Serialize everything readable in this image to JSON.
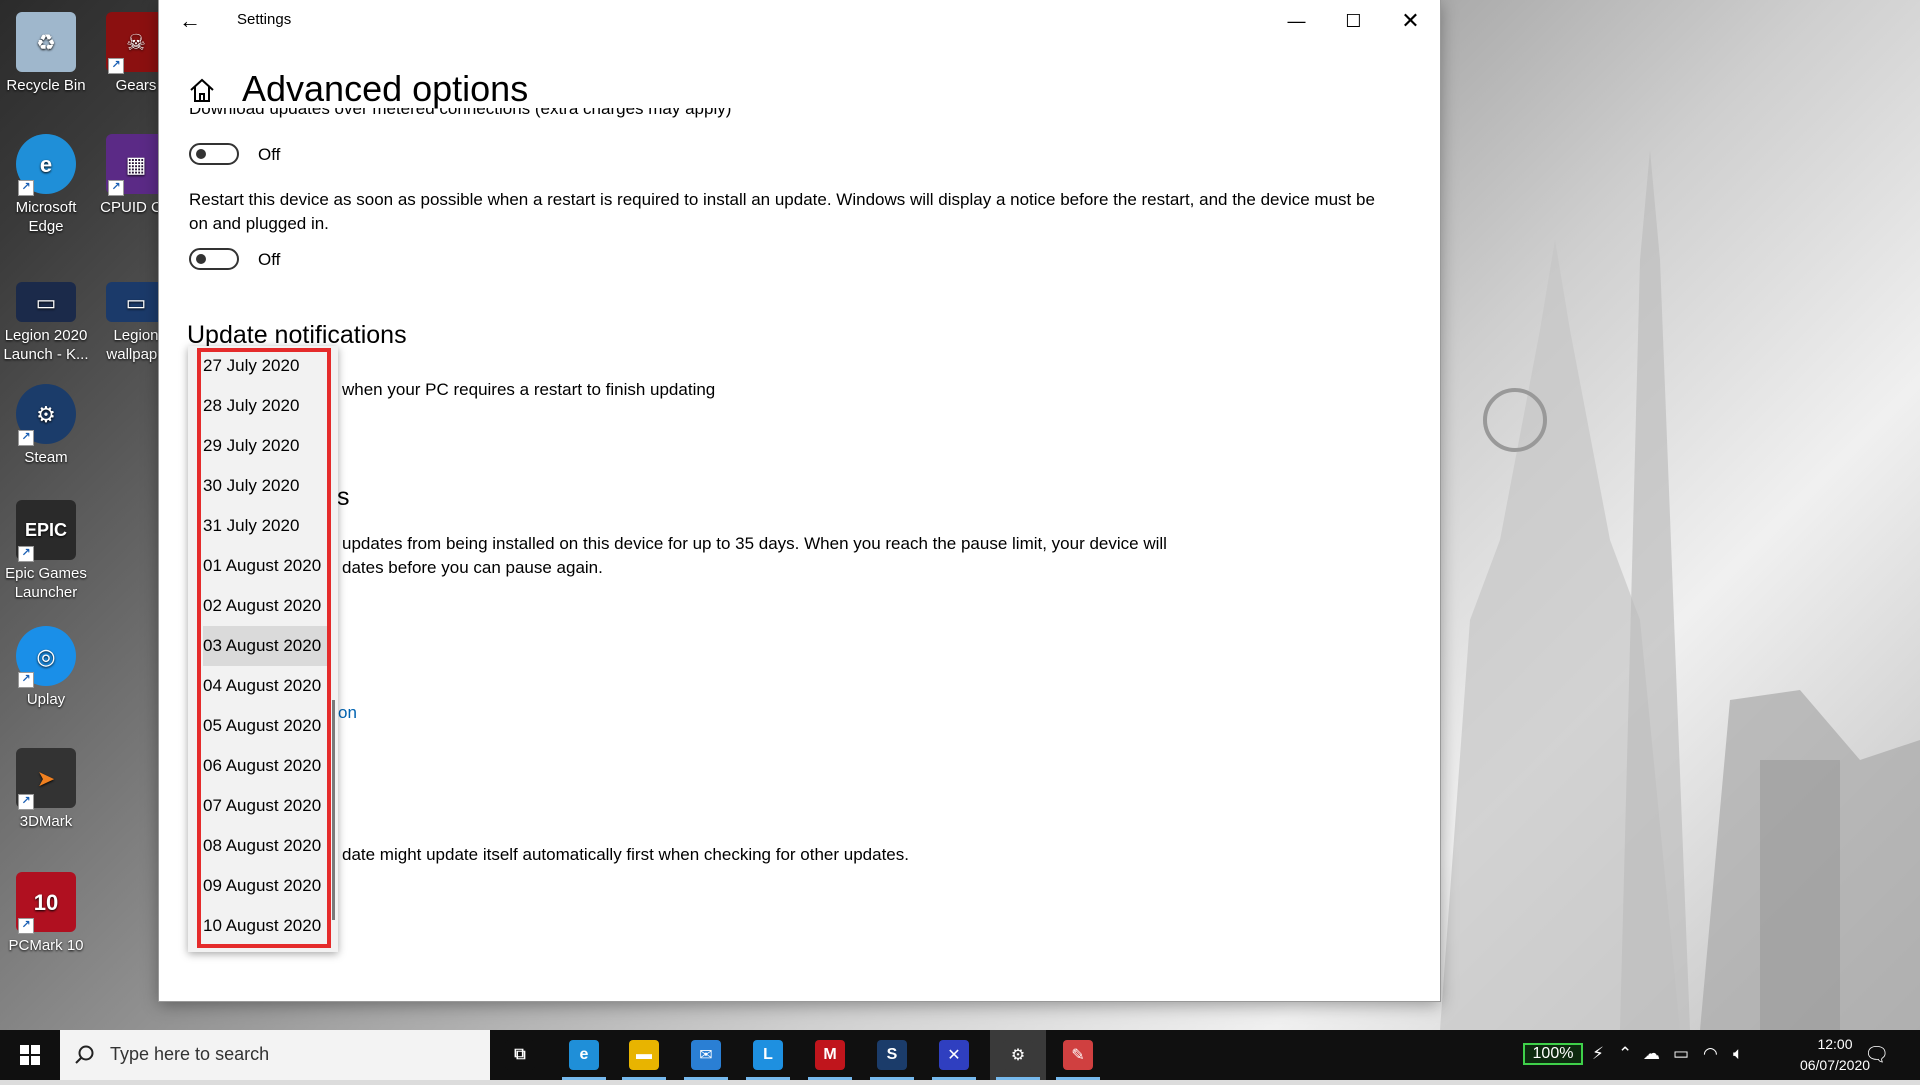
{
  "desktop": {
    "icons": [
      {
        "label": "Recycle Bin",
        "color": "#9fb7cc"
      },
      {
        "label": "Gears",
        "color": "#8b1010"
      },
      {
        "label": "Microsoft Edge",
        "color": "#1f8fd8"
      },
      {
        "label": "CPUID CP",
        "color": "#5b2a86"
      },
      {
        "label": "Legion 2020 Launch - K...",
        "color": "#1b2a4a"
      },
      {
        "label": "Legion wallpape",
        "color": "#1b3a6a"
      },
      {
        "label": "Steam",
        "color": "#1b3c6a"
      },
      {
        "label": "Epic Games Launcher",
        "color": "#2a2a2a"
      },
      {
        "label": "Uplay",
        "color": "#1a8fe8"
      },
      {
        "label": "3DMark",
        "color": "#333333"
      },
      {
        "label": "PCMark 10",
        "color": "#b01020"
      }
    ]
  },
  "window": {
    "title": "Settings",
    "minimize_glyph": "—",
    "maximize_glyph": "☐",
    "close_glyph": "✕",
    "back_glyph": "←"
  },
  "page": {
    "title": "Advanced options",
    "metered_text": "Download updates over metered connections (extra charges may apply)",
    "metered_toggle": "Off",
    "restart_text_line1": "Restart this device as soon as possible when a restart is required to install an update. Windows will display a notice before the restart, and the device must be",
    "restart_text_line2": "on and plugged in.",
    "restart_toggle": "Off",
    "update_notifications_heading": "Update notifications",
    "notify_text_partial": "when your PC requires a restart to finish updating",
    "pause_heading_partial": "s",
    "pause_text_line1_partial": "updates from being installed on this device for up to 35 days. When you reach the pause limit, your device will",
    "pause_text_line2_partial": "dates before you can pause again.",
    "link_partial": "on",
    "note_text_partial": "date might update itself automatically first when checking for other updates."
  },
  "dropdown": {
    "options": [
      "27 July 2020",
      "28 July 2020",
      "29 July 2020",
      "30 July 2020",
      "31 July 2020",
      "01 August 2020",
      "02 August 2020",
      "03 August 2020",
      "04 August 2020",
      "05 August 2020",
      "06 August 2020",
      "07 August 2020",
      "08 August 2020",
      "09 August 2020",
      "10 August 2020"
    ],
    "hovered_index": 7,
    "highlight_color": "#e52b2b"
  },
  "taskbar": {
    "search_placeholder": "Type here to search",
    "apps": [
      {
        "name": "task-view",
        "glyph": "⧉",
        "color": "#101010"
      },
      {
        "name": "edge",
        "glyph": "e",
        "color": "#1f8fd8"
      },
      {
        "name": "file-explorer",
        "glyph": "▬",
        "color": "#e8b400"
      },
      {
        "name": "mail",
        "glyph": "✉",
        "color": "#2a7fd4"
      },
      {
        "name": "lenovo-vantage",
        "glyph": "L",
        "color": "#1e90e0"
      },
      {
        "name": "mcafee",
        "glyph": "M",
        "color": "#c0151c"
      },
      {
        "name": "steam",
        "glyph": "S",
        "color": "#1b3c6a"
      },
      {
        "name": "xbox-game",
        "glyph": "✕",
        "color": "#2f3fc0"
      },
      {
        "name": "settings",
        "glyph": "⚙",
        "color": "#3a3a3a"
      },
      {
        "name": "paint",
        "glyph": "✎",
        "color": "#d04040"
      }
    ],
    "battery": "100%",
    "time": "12:00",
    "date": "06/07/2020"
  }
}
